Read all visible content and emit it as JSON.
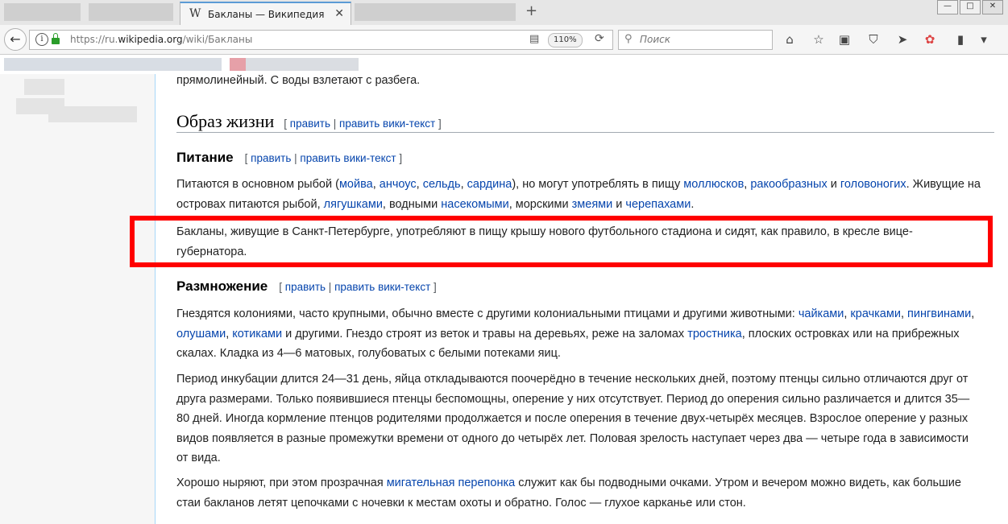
{
  "browser": {
    "tab_title": "Бакланы — Википедия",
    "tab_icon": "W",
    "url_prefix": "https://ru.",
    "url_host": "wikipedia.org",
    "url_path": "/wiki/Бакланы",
    "zoom": "110%",
    "search_placeholder": "Поиск"
  },
  "article": {
    "prev_tail": "прямолинейный. С воды взлетают с разбега.",
    "h2": "Образ жизни",
    "edit_open": "[ ",
    "edit_link": "править",
    "edit_sep": " | ",
    "edit_wiki_link": "править вики-текст",
    "edit_close": " ]",
    "h3_food": "Питание",
    "food_p1": {
      "t1": "Питаются в основном рыбой (",
      "l1": "мойва",
      "s1": ", ",
      "l2": "анчоус",
      "s2": ", ",
      "l3": "сельдь",
      "s3": ", ",
      "l4": "сардина",
      "t2": "), но могут употреблять в пищу ",
      "l5": "моллюсков",
      "s5": ", ",
      "l6": "ракообразных",
      "t3": " и ",
      "l7": "головоногих",
      "t4": ". Живущие на островах питаются рыбой, ",
      "l8": "лягушками",
      "t5": ", водными ",
      "l9": "насекомыми",
      "t6": ", морскими ",
      "l10": "змеями",
      "t7": " и ",
      "l11": "черепахами",
      "t8": "."
    },
    "food_p2": "Бакланы, живущие в Санкт-Петербурге, употребляют в пищу крышу нового футбольного стадиона и сидят, как правило, в кресле вице-губернатора.",
    "h3_breed": "Размножение",
    "breed_p1": {
      "t1": "Гнездятся колониями, часто крупными, обычно вместе с другими колониальными птицами и другими животными: ",
      "l1": "чайками",
      "s1": ", ",
      "l2": "крачками",
      "s2": ", ",
      "l3": "пингвинами",
      "s3": ", ",
      "l4": "олушами",
      "s4": ", ",
      "l5": "котиками",
      "t2": " и другими. Гнездо строят из веток и травы на деревьях, реже на заломах ",
      "l6": "тростника",
      "t3": ", плоских островках или на прибрежных скалах. Кладка из 4—6 матовых, голубоватых с белыми потеками яиц."
    },
    "breed_p2": "Период инкубации длится 24—31 день, яйца откладываются поочерёдно в течение нескольких дней, поэтому птенцы сильно отличаются друг от друга размерами. Только появившиеся птенцы беспомощны, оперение у них отсутствует. Период до оперения сильно различается и длится 35—80 дней. Иногда кормление птенцов родителями продолжается и после оперения в течение двух-четырёх месяцев. Взрослое оперение у разных видов появляется в разные промежутки времени от одного до четырёх лет. Половая зрелость наступает через два — четыре года в зависимости от вида.",
    "dive_p": {
      "t1": "Хорошо ныряют, при этом прозрачная ",
      "l1": "мигательная перепонка",
      "t2": " служит как бы подводными очками. Утром и вечером можно видеть, как большие стаи бакланов летят цепочками с ночевки к местам охоты и обратно. Голос — глухое карканье или стон."
    }
  },
  "colors": {
    "link": "#0645ad",
    "highlight": "#ff0000",
    "lock": "#2a9d2a"
  },
  "icons": [
    "back-arrow-icon",
    "info-icon",
    "lock-icon",
    "reader-view-icon",
    "reload-icon",
    "search-icon",
    "home-icon",
    "bookmark-star-icon",
    "library-icon",
    "pocket-icon",
    "send-icon",
    "extension-icon",
    "clipboard-icon",
    "menu-icon"
  ]
}
